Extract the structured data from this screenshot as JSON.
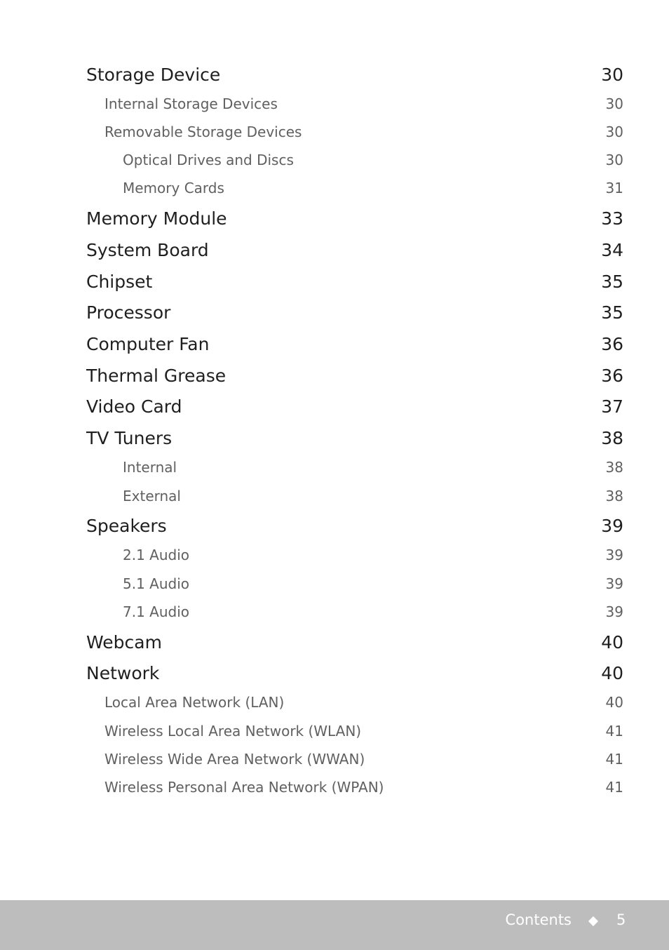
{
  "toc": {
    "entries": [
      {
        "title": "Storage Device",
        "page": "30",
        "level": 1
      },
      {
        "title": "Internal Storage Devices",
        "page": "30",
        "level": 2
      },
      {
        "title": "Removable Storage Devices",
        "page": "30",
        "level": 2
      },
      {
        "title": "Optical Drives and Discs",
        "page": "30",
        "level": 3
      },
      {
        "title": "Memory Cards",
        "page": "31",
        "level": 3
      },
      {
        "title": "Memory Module",
        "page": "33",
        "level": 1
      },
      {
        "title": "System Board",
        "page": "34",
        "level": 1
      },
      {
        "title": "Chipset",
        "page": "35",
        "level": 1
      },
      {
        "title": "Processor",
        "page": "35",
        "level": 1
      },
      {
        "title": "Computer Fan",
        "page": "36",
        "level": 1
      },
      {
        "title": "Thermal Grease",
        "page": "36",
        "level": 1
      },
      {
        "title": "Video Card",
        "page": "37",
        "level": 1
      },
      {
        "title": "TV Tuners",
        "page": "38",
        "level": 1
      },
      {
        "title": "Internal",
        "page": "38",
        "level": 3
      },
      {
        "title": "External",
        "page": "38",
        "level": 3
      },
      {
        "title": "Speakers",
        "page": "39",
        "level": 1
      },
      {
        "title": "2.1 Audio",
        "page": "39",
        "level": 3
      },
      {
        "title": "5.1 Audio",
        "page": "39",
        "level": 3
      },
      {
        "title": "7.1 Audio",
        "page": "39",
        "level": 3
      },
      {
        "title": "Webcam",
        "page": "40",
        "level": 1
      },
      {
        "title": "Network",
        "page": "40",
        "level": 1
      },
      {
        "title": "Local Area Network (LAN)",
        "page": "40",
        "level": 2
      },
      {
        "title": "Wireless Local Area Network (WLAN)",
        "page": "41",
        "level": 2
      },
      {
        "title": "Wireless Wide Area Network (WWAN)",
        "page": "41",
        "level": 2
      },
      {
        "title": "Wireless Personal Area Network (WPAN)",
        "page": "41",
        "level": 2
      }
    ]
  },
  "footer": {
    "section_label": "Contents",
    "separator_icon": "diamond-icon",
    "page_number": "5"
  }
}
